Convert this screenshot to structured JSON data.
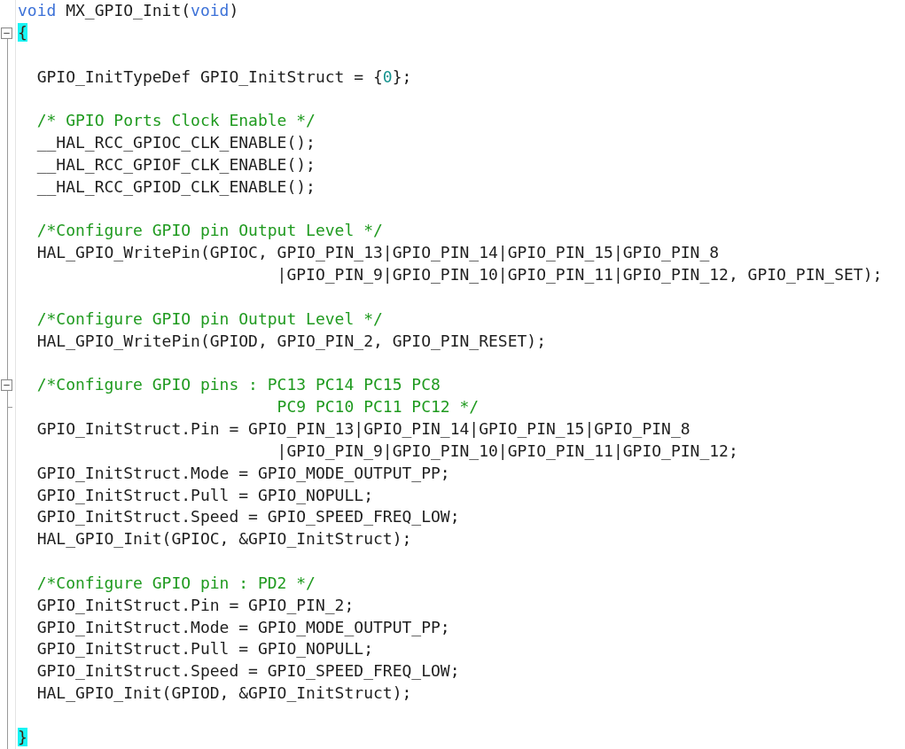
{
  "editor": {
    "lines": [
      {
        "kind": "code",
        "tokens": [
          {
            "kind": "keyword",
            "text": "void"
          },
          {
            "kind": "text",
            "text": " MX_GPIO_Init("
          },
          {
            "kind": "keyword",
            "text": "void"
          },
          {
            "kind": "text",
            "text": ")"
          }
        ]
      },
      {
        "kind": "code",
        "fold": {
          "expanded": true
        },
        "tokens": [
          {
            "kind": "brace",
            "text": "{",
            "highlighted": true
          }
        ]
      },
      {
        "kind": "blank"
      },
      {
        "kind": "code",
        "tokens": [
          {
            "kind": "text",
            "text": "  GPIO_InitTypeDef GPIO_InitStruct = {"
          },
          {
            "kind": "number",
            "text": "0"
          },
          {
            "kind": "text",
            "text": "};"
          }
        ]
      },
      {
        "kind": "blank"
      },
      {
        "kind": "code",
        "tokens": [
          {
            "kind": "comment",
            "text": "  /* GPIO Ports Clock Enable */"
          }
        ]
      },
      {
        "kind": "code",
        "tokens": [
          {
            "kind": "text",
            "text": "  __HAL_RCC_GPIOC_CLK_ENABLE();"
          }
        ]
      },
      {
        "kind": "code",
        "tokens": [
          {
            "kind": "text",
            "text": "  __HAL_RCC_GPIOF_CLK_ENABLE();"
          }
        ]
      },
      {
        "kind": "code",
        "tokens": [
          {
            "kind": "text",
            "text": "  __HAL_RCC_GPIOD_CLK_ENABLE();"
          }
        ]
      },
      {
        "kind": "blank"
      },
      {
        "kind": "code",
        "tokens": [
          {
            "kind": "comment",
            "text": "  /*Configure GPIO pin Output Level */"
          }
        ]
      },
      {
        "kind": "code",
        "tokens": [
          {
            "kind": "text",
            "text": "  HAL_GPIO_WritePin(GPIOC, GPIO_PIN_13|GPIO_PIN_14|GPIO_PIN_15|GPIO_PIN_8"
          }
        ]
      },
      {
        "kind": "code",
        "tokens": [
          {
            "kind": "text",
            "text": "                           |GPIO_PIN_9|GPIO_PIN_10|GPIO_PIN_11|GPIO_PIN_12, GPIO_PIN_SET);"
          }
        ]
      },
      {
        "kind": "blank"
      },
      {
        "kind": "code",
        "tokens": [
          {
            "kind": "comment",
            "text": "  /*Configure GPIO pin Output Level */"
          }
        ]
      },
      {
        "kind": "code",
        "tokens": [
          {
            "kind": "text",
            "text": "  HAL_GPIO_WritePin(GPIOD, GPIO_PIN_2, GPIO_PIN_RESET);"
          }
        ]
      },
      {
        "kind": "blank"
      },
      {
        "kind": "code",
        "fold": {
          "expanded": true
        },
        "tokens": [
          {
            "kind": "comment",
            "text": "  /*Configure GPIO pins : PC13 PC14 PC15 PC8"
          }
        ]
      },
      {
        "kind": "code",
        "fold_end": true,
        "tokens": [
          {
            "kind": "comment",
            "text": "                           PC9 PC10 PC11 PC12 */"
          }
        ]
      },
      {
        "kind": "code",
        "tokens": [
          {
            "kind": "text",
            "text": "  GPIO_InitStruct.Pin = GPIO_PIN_13|GPIO_PIN_14|GPIO_PIN_15|GPIO_PIN_8"
          }
        ]
      },
      {
        "kind": "code",
        "tokens": [
          {
            "kind": "text",
            "text": "                           |GPIO_PIN_9|GPIO_PIN_10|GPIO_PIN_11|GPIO_PIN_12;"
          }
        ]
      },
      {
        "kind": "code",
        "tokens": [
          {
            "kind": "text",
            "text": "  GPIO_InitStruct.Mode = GPIO_MODE_OUTPUT_PP;"
          }
        ]
      },
      {
        "kind": "code",
        "tokens": [
          {
            "kind": "text",
            "text": "  GPIO_InitStruct.Pull = GPIO_NOPULL;"
          }
        ]
      },
      {
        "kind": "code",
        "tokens": [
          {
            "kind": "text",
            "text": "  GPIO_InitStruct.Speed = GPIO_SPEED_FREQ_LOW;"
          }
        ]
      },
      {
        "kind": "code",
        "tokens": [
          {
            "kind": "text",
            "text": "  HAL_GPIO_Init(GPIOC, &GPIO_InitStruct);"
          }
        ]
      },
      {
        "kind": "blank"
      },
      {
        "kind": "code",
        "tokens": [
          {
            "kind": "comment",
            "text": "  /*Configure GPIO pin : PD2 */"
          }
        ]
      },
      {
        "kind": "code",
        "tokens": [
          {
            "kind": "text",
            "text": "  GPIO_InitStruct.Pin = GPIO_PIN_2;"
          }
        ]
      },
      {
        "kind": "code",
        "tokens": [
          {
            "kind": "text",
            "text": "  GPIO_InitStruct.Mode = GPIO_MODE_OUTPUT_PP;"
          }
        ]
      },
      {
        "kind": "code",
        "tokens": [
          {
            "kind": "text",
            "text": "  GPIO_InitStruct.Pull = GPIO_NOPULL;"
          }
        ]
      },
      {
        "kind": "code",
        "tokens": [
          {
            "kind": "text",
            "text": "  GPIO_InitStruct.Speed = GPIO_SPEED_FREQ_LOW;"
          }
        ]
      },
      {
        "kind": "code",
        "tokens": [
          {
            "kind": "text",
            "text": "  HAL_GPIO_Init(GPIOD, &GPIO_InitStruct);"
          }
        ]
      },
      {
        "kind": "blank"
      },
      {
        "kind": "code",
        "tokens": [
          {
            "kind": "brace",
            "text": "}",
            "highlighted": true
          }
        ]
      }
    ]
  }
}
